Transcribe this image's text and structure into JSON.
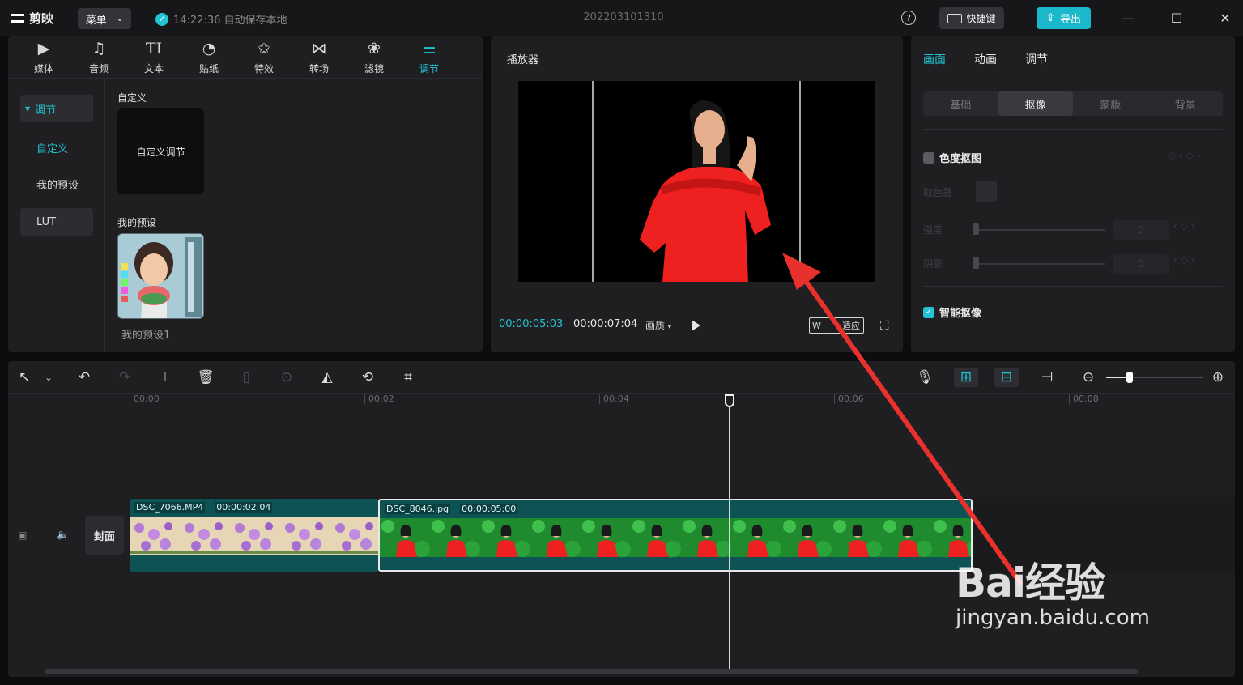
{
  "titlebar": {
    "app_name": "剪映",
    "menu_label": "菜单",
    "save_status": "14:22:36 自动保存本地",
    "project_title": "202203101310",
    "shortcut_label": "快捷键",
    "export_label": "导出"
  },
  "toolbar_tabs": [
    {
      "label": "媒体",
      "icon": "media-icon"
    },
    {
      "label": "音频",
      "icon": "audio-icon"
    },
    {
      "label": "文本",
      "icon": "text-icon"
    },
    {
      "label": "贴纸",
      "icon": "sticker-icon"
    },
    {
      "label": "特效",
      "icon": "effects-icon"
    },
    {
      "label": "转场",
      "icon": "transition-icon"
    },
    {
      "label": "滤镜",
      "icon": "filter-icon"
    },
    {
      "label": "调节",
      "icon": "adjust-icon",
      "active": true
    }
  ],
  "side_nav": {
    "section": "调节",
    "custom": "自定义",
    "my_presets": "我的预设",
    "lut": "LUT"
  },
  "library": {
    "custom_heading": "自定义",
    "custom_card": "自定义调节",
    "presets_heading": "我的预设",
    "preset_name": "我的预设1"
  },
  "player": {
    "title": "播放器",
    "current_time": "00:00:05:03",
    "total_time": "00:00:07:04",
    "quality": "画质",
    "fit_label": "适应"
  },
  "inspector": {
    "tabs": [
      "画面",
      "动画",
      "调节"
    ],
    "segments": [
      "基础",
      "抠像",
      "蒙版",
      "背景"
    ],
    "chroma_key_label": "色度抠图",
    "chroma_key_checked": false,
    "color_picker_label": "取色器",
    "intensity_label": "强度",
    "intensity_value": "0",
    "shadow_label": "阴影",
    "shadow_value": "0",
    "smart_cutout_label": "智能抠像",
    "smart_cutout_checked": true
  },
  "timeline": {
    "ruler": [
      "00:00",
      "00:02",
      "00:04",
      "00:06",
      "00:08"
    ],
    "cover_label": "封面",
    "clips": [
      {
        "name": "DSC_7066.MP4",
        "duration": "00:00:02:04"
      },
      {
        "name": "DSC_8046.jpg",
        "duration": "00:00:05:00"
      }
    ],
    "zoom_fraction": 0.25
  },
  "watermark": {
    "main": "Bai经验",
    "sub": "jingyan.baidu.com"
  },
  "colors": {
    "accent": "#22c3d4",
    "annotation_arrow": "#e8302c"
  }
}
